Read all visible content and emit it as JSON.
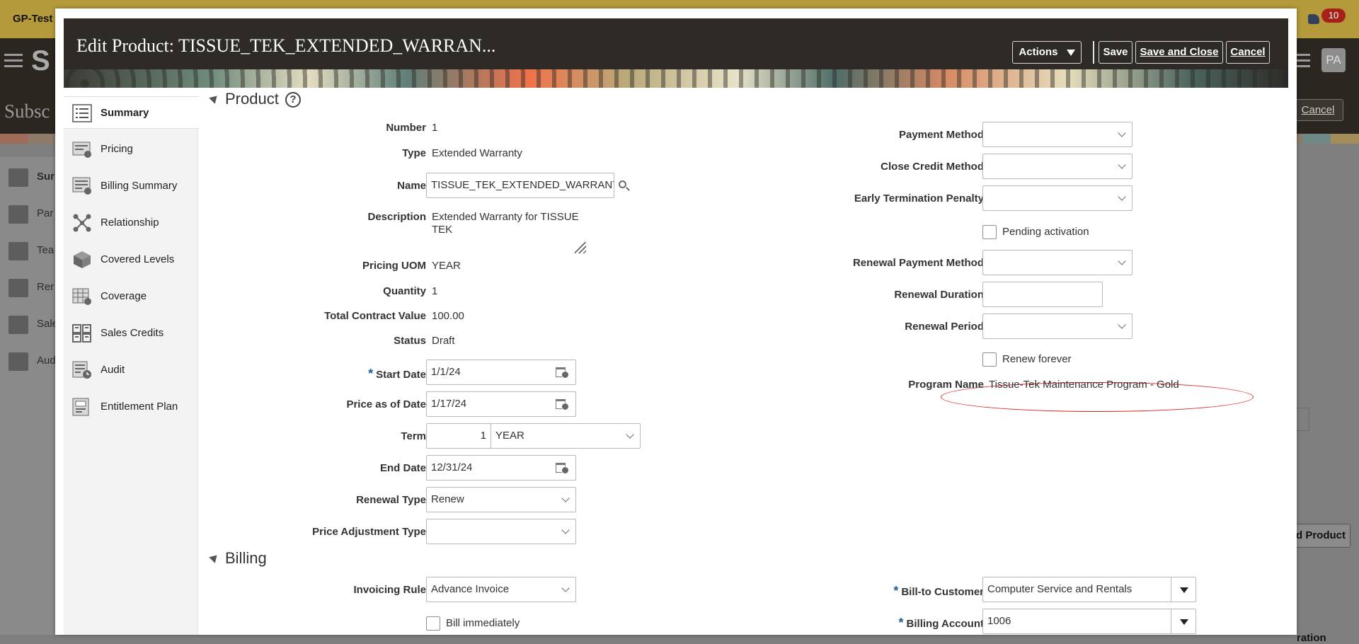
{
  "background": {
    "env_label": "GP-Test",
    "notification_count": "10",
    "page_title": "Subsc",
    "avatar": "PA",
    "cancel_label": "Cancel",
    "sidebar": [
      "Sur",
      "Par",
      "Tea",
      "Rer",
      "Sale",
      "Aud"
    ],
    "right_button": "d Product",
    "right_text": "ration"
  },
  "dialog": {
    "title": "Edit Product: TISSUE_TEK_EXTENDED_WARRAN...",
    "actions_label": "Actions",
    "save_label": "Save",
    "save_close_label": "Save and Close",
    "cancel_label": "Cancel"
  },
  "nav": {
    "items": [
      {
        "label": "Summary",
        "icon": "summary-icon"
      },
      {
        "label": "Pricing",
        "icon": "pricing-icon"
      },
      {
        "label": "Billing Summary",
        "icon": "billing-summary-icon"
      },
      {
        "label": "Relationship",
        "icon": "relationship-icon"
      },
      {
        "label": "Covered Levels",
        "icon": "covered-levels-icon"
      },
      {
        "label": "Coverage",
        "icon": "coverage-icon"
      },
      {
        "label": "Sales Credits",
        "icon": "sales-credits-icon"
      },
      {
        "label": "Audit",
        "icon": "audit-icon"
      },
      {
        "label": "Entitlement Plan",
        "icon": "entitlement-plan-icon"
      }
    ]
  },
  "product": {
    "section_title": "Product",
    "number_label": "Number",
    "number": "1",
    "type_label": "Type",
    "type": "Extended Warranty",
    "name_label": "Name",
    "name": "TISSUE_TEK_EXTENDED_WARRANTY",
    "description_label": "Description",
    "description_line1": "Extended Warranty for TISSUE",
    "description_line2": "TEK",
    "pricing_uom_label": "Pricing UOM",
    "pricing_uom": "YEAR",
    "quantity_label": "Quantity",
    "quantity": "1",
    "tcv_label": "Total Contract Value",
    "tcv": "100.00",
    "status_label": "Status",
    "status": "Draft",
    "start_date_label": "Start Date",
    "start_date": "1/1/24",
    "price_as_of_label": "Price as of Date",
    "price_as_of": "1/17/24",
    "term_label": "Term",
    "term_value": "1",
    "term_unit": "YEAR",
    "end_date_label": "End Date",
    "end_date": "12/31/24",
    "renewal_type_label": "Renewal Type",
    "renewal_type": "Renew",
    "price_adjustment_label": "Price Adjustment Type",
    "price_adjustment": "",
    "payment_method_label": "Payment Method",
    "payment_method": "",
    "close_credit_label": "Close Credit Method",
    "close_credit": "",
    "early_termination_label": "Early Termination Penalty",
    "early_termination": "",
    "pending_activation_label": "Pending activation",
    "renewal_payment_label": "Renewal Payment Method",
    "renewal_payment": "",
    "renewal_duration_label": "Renewal Duration",
    "renewal_duration": "",
    "renewal_period_label": "Renewal Period",
    "renewal_period": "",
    "renew_forever_label": "Renew forever",
    "program_name_label": "Program Name",
    "program_name": "Tissue-Tek Maintenance Program - Gold"
  },
  "billing": {
    "section_title": "Billing",
    "invoicing_rule_label": "Invoicing Rule",
    "invoicing_rule": "Advance Invoice",
    "bill_immediately_label": "Bill immediately",
    "bill_to_customer_label": "Bill-to Customer",
    "bill_to_customer": "Computer Service and Rentals",
    "billing_account_label": "Billing Account",
    "billing_account": "1006"
  },
  "colors": {
    "header_bg": "#2e2b27",
    "required": "#1a5f9e",
    "highlight": "#e02020"
  }
}
